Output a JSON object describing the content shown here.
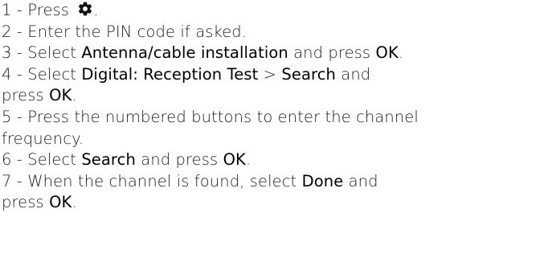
{
  "steps": [
    {
      "num": "1 - ",
      "parts": [
        {
          "t": "Press ",
          "b": false
        }
      ],
      "icon": "gear-icon",
      "after_icon": "."
    },
    {
      "num": "2 - ",
      "parts": [
        {
          "t": " Enter the PIN code if asked.",
          "b": false
        }
      ]
    },
    {
      "num": "3 - ",
      "parts": [
        {
          "t": " Select ",
          "b": false
        },
        {
          "t": "Antenna/cable installation",
          "b": true
        },
        {
          "t": " and press ",
          "b": false
        },
        {
          "t": "  OK",
          "b": true
        },
        {
          "t": ".",
          "b": false
        }
      ]
    },
    {
      "num": "4 - ",
      "parts": [
        {
          "t": " Select ",
          "b": false
        },
        {
          "t": " Digital: Reception Test",
          "b": true
        },
        {
          "t": " > ",
          "b": false
        },
        {
          "t": " Search",
          "b": true
        },
        {
          "t": " and",
          "b": false
        }
      ]
    },
    {
      "num": "",
      "parts": [
        {
          "t": "press ",
          "b": false
        },
        {
          "t": "OK",
          "b": true
        },
        {
          "t": ".",
          "b": false
        }
      ]
    },
    {
      "num": "5 - ",
      "parts": [
        {
          "t": " Press the numbered buttons to enter the channel",
          "b": false
        }
      ]
    },
    {
      "num": "",
      "parts": [
        {
          "t": "frequency.",
          "b": false
        }
      ]
    },
    {
      "num": "6 - ",
      "parts": [
        {
          "t": " Select ",
          "b": false
        },
        {
          "t": "Search",
          "b": true
        },
        {
          "t": " and press ",
          "b": false
        },
        {
          "t": " OK",
          "b": true
        },
        {
          "t": ".",
          "b": false
        }
      ]
    },
    {
      "num": "7 - ",
      "parts": [
        {
          "t": " When the channel is found, select ",
          "b": false
        },
        {
          "t": " Done",
          "b": true
        },
        {
          "t": " and",
          "b": false
        }
      ]
    },
    {
      "num": "",
      "parts": [
        {
          "t": "press ",
          "b": false
        },
        {
          "t": " OK",
          "b": true
        },
        {
          "t": ".",
          "b": false
        }
      ]
    }
  ]
}
